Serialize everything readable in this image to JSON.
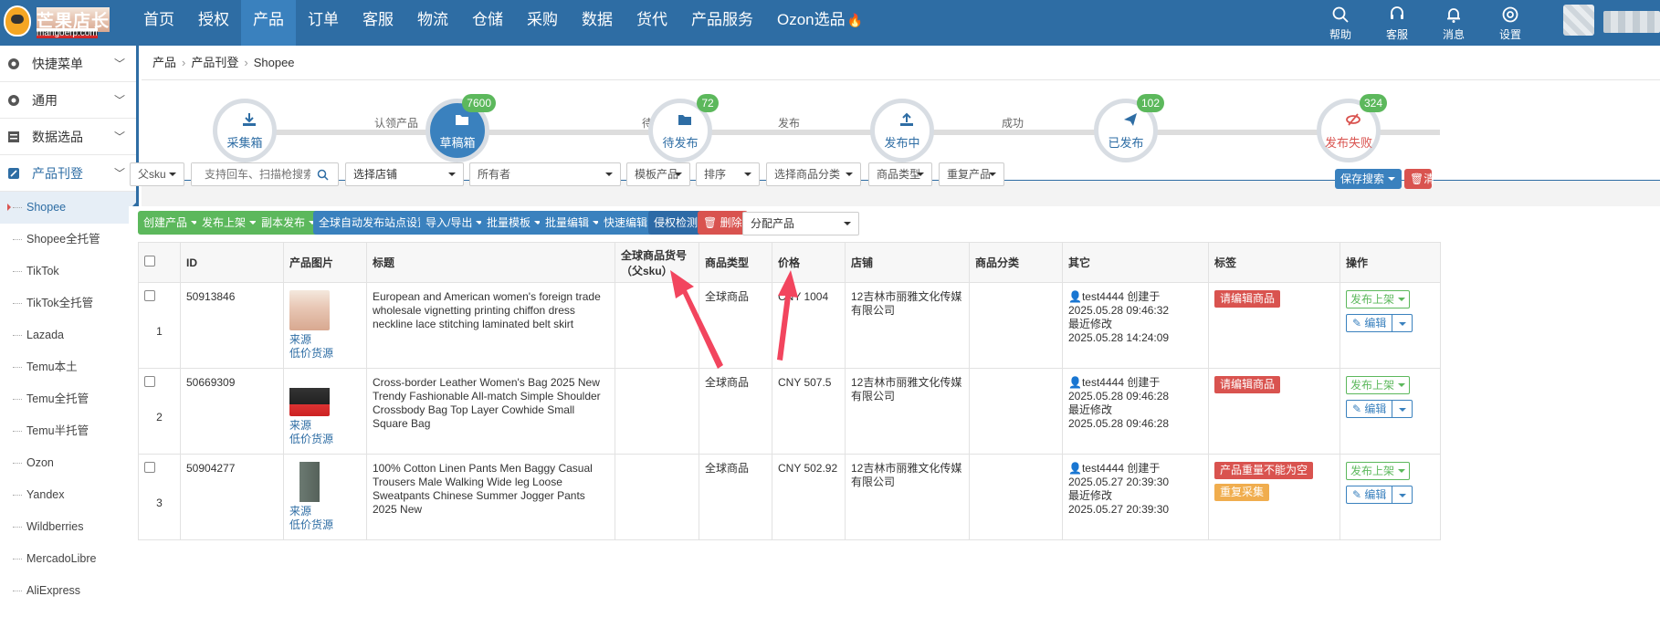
{
  "app": {
    "logo_title": "芒果店长",
    "logo_sub": "mangoerp.com"
  },
  "nav": [
    "首页",
    "授权",
    "产品",
    "订单",
    "客服",
    "物流",
    "仓储",
    "采购",
    "数据",
    "货代",
    "产品服务",
    "Ozon选品"
  ],
  "nav_active": "产品",
  "tools": [
    "帮助",
    "客服",
    "消息",
    "设置"
  ],
  "sidebar": {
    "groups": [
      "快捷菜单",
      "通用",
      "数据选品",
      "产品刊登"
    ],
    "items": [
      "Shopee",
      "Shopee全托管",
      "TikTok",
      "TikTok全托管",
      "Lazada",
      "Temu本土",
      "Temu全托管",
      "Temu半托管",
      "Ozon",
      "Yandex",
      "Wildberries",
      "MercadoLibre",
      "AliExpress"
    ]
  },
  "breadcrumb": [
    "产品",
    "产品刊登",
    "Shopee"
  ],
  "steps": [
    {
      "label": "采集箱",
      "badge": ""
    },
    {
      "label": "草稿箱",
      "badge": "7600"
    },
    {
      "label": "待发布",
      "badge": "72"
    },
    {
      "label": "发布中",
      "badge": ""
    },
    {
      "label": "已发布",
      "badge": "102"
    },
    {
      "label": "发布失败",
      "badge": "324"
    }
  ],
  "step_links": [
    "认领产品",
    "待发布",
    "发布",
    "成功"
  ],
  "filters": {
    "parent_sku": "父sku",
    "search_placeholder": "支持回车、扫描枪搜索",
    "store": "选择店铺",
    "owner": "所有者",
    "template": "模板产品",
    "sort": "排序",
    "category": "选择商品分类",
    "type": "商品类型",
    "duplicate": "重复产品",
    "save_search": "保存搜索",
    "clear": "清"
  },
  "actions": [
    "创建产品",
    "发布上架",
    "副本发布",
    "全球自动发布站点设置",
    "导入/导出",
    "批量模板",
    "批量编辑",
    "快速编辑",
    "侵权检测",
    "删除"
  ],
  "assign": "分配产品",
  "table": {
    "headers": [
      "ID",
      "产品图片",
      "标题",
      "全球商品货号（父sku）",
      "商品类型",
      "价格",
      "店铺",
      "商品分类",
      "其它",
      "标签",
      "操作"
    ],
    "source_label": "来源",
    "cheap_label": "低价货源",
    "created_label": "创建于",
    "updated_label": "最近修改",
    "publish_btn": "发布上架",
    "edit_btn": "编辑",
    "rows": [
      {
        "num": "1",
        "id": "50913846",
        "title": "European and American women's foreign trade wholesale vignetting printing chiffon dress neckline lace stitching laminated belt skirt",
        "parent_sku": "",
        "type": "全球商品",
        "price": "CNY 1004",
        "store": "12吉林市丽雅文化传媒有限公司",
        "category": "",
        "user": "test4444",
        "created": "2025.05.28 09:46:32",
        "updated": "2025.05.28 14:24:09",
        "tags": [
          "请编辑商品"
        ]
      },
      {
        "num": "2",
        "id": "50669309",
        "title": "Cross-border Leather Women's Bag 2025 New Trendy Fashionable All-match Simple Shoulder Crossbody Bag Top Layer Cowhide Small Square Bag",
        "parent_sku": "",
        "type": "全球商品",
        "price": "CNY 507.5",
        "store": "12吉林市丽雅文化传媒有限公司",
        "category": "",
        "user": "test4444",
        "created": "2025.05.28 09:46:28",
        "updated": "2025.05.28 09:46:28",
        "tags": [
          "请编辑商品"
        ]
      },
      {
        "num": "3",
        "id": "50904277",
        "title": "100% Cotton Linen Pants Men Baggy Casual Trousers Male Walking Wide leg Loose Sweatpants Chinese Summer Jogger Pants 2025 New",
        "parent_sku": "",
        "type": "全球商品",
        "price": "CNY 502.92",
        "store": "12吉林市丽雅文化传媒有限公司",
        "category": "",
        "user": "test4444",
        "created": "2025.05.27 20:39:30",
        "updated": "2025.05.27 20:39:30",
        "tags": [
          "产品重量不能为空",
          "重复采集"
        ]
      }
    ]
  },
  "colors": {
    "brand": "#2e6da4",
    "green": "#5cb85c",
    "red": "#d9534f",
    "orange": "#f0ad4e",
    "annotation": "#f2455e"
  }
}
